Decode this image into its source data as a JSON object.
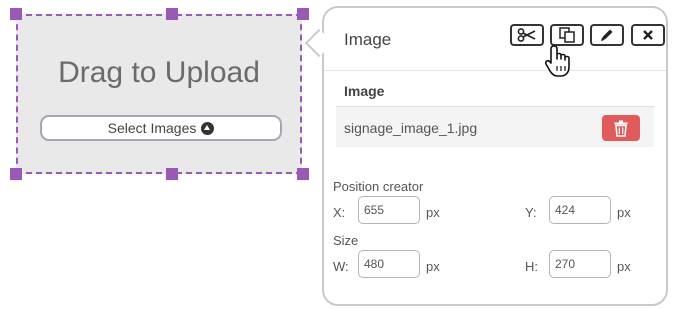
{
  "upload": {
    "title": "Drag to Upload",
    "button_label": "Select Images"
  },
  "panel": {
    "title": "Image",
    "toolbar": [
      "cut-icon",
      "copy-icon",
      "edit-icon",
      "close-icon"
    ],
    "image_section": {
      "label": "Image",
      "file_name": "signage_image_1.jpg"
    },
    "position": {
      "label": "Position creator",
      "x_label": "X:",
      "x_value": "655",
      "y_label": "Y:",
      "y_value": "424",
      "unit": "px"
    },
    "size": {
      "label": "Size",
      "w_label": "W:",
      "w_value": "480",
      "h_label": "H:",
      "h_value": "270",
      "unit": "px"
    }
  },
  "colors": {
    "selection": "#9b59b6",
    "delete": "#e05b5b",
    "panel_border": "#c9c9c9"
  }
}
